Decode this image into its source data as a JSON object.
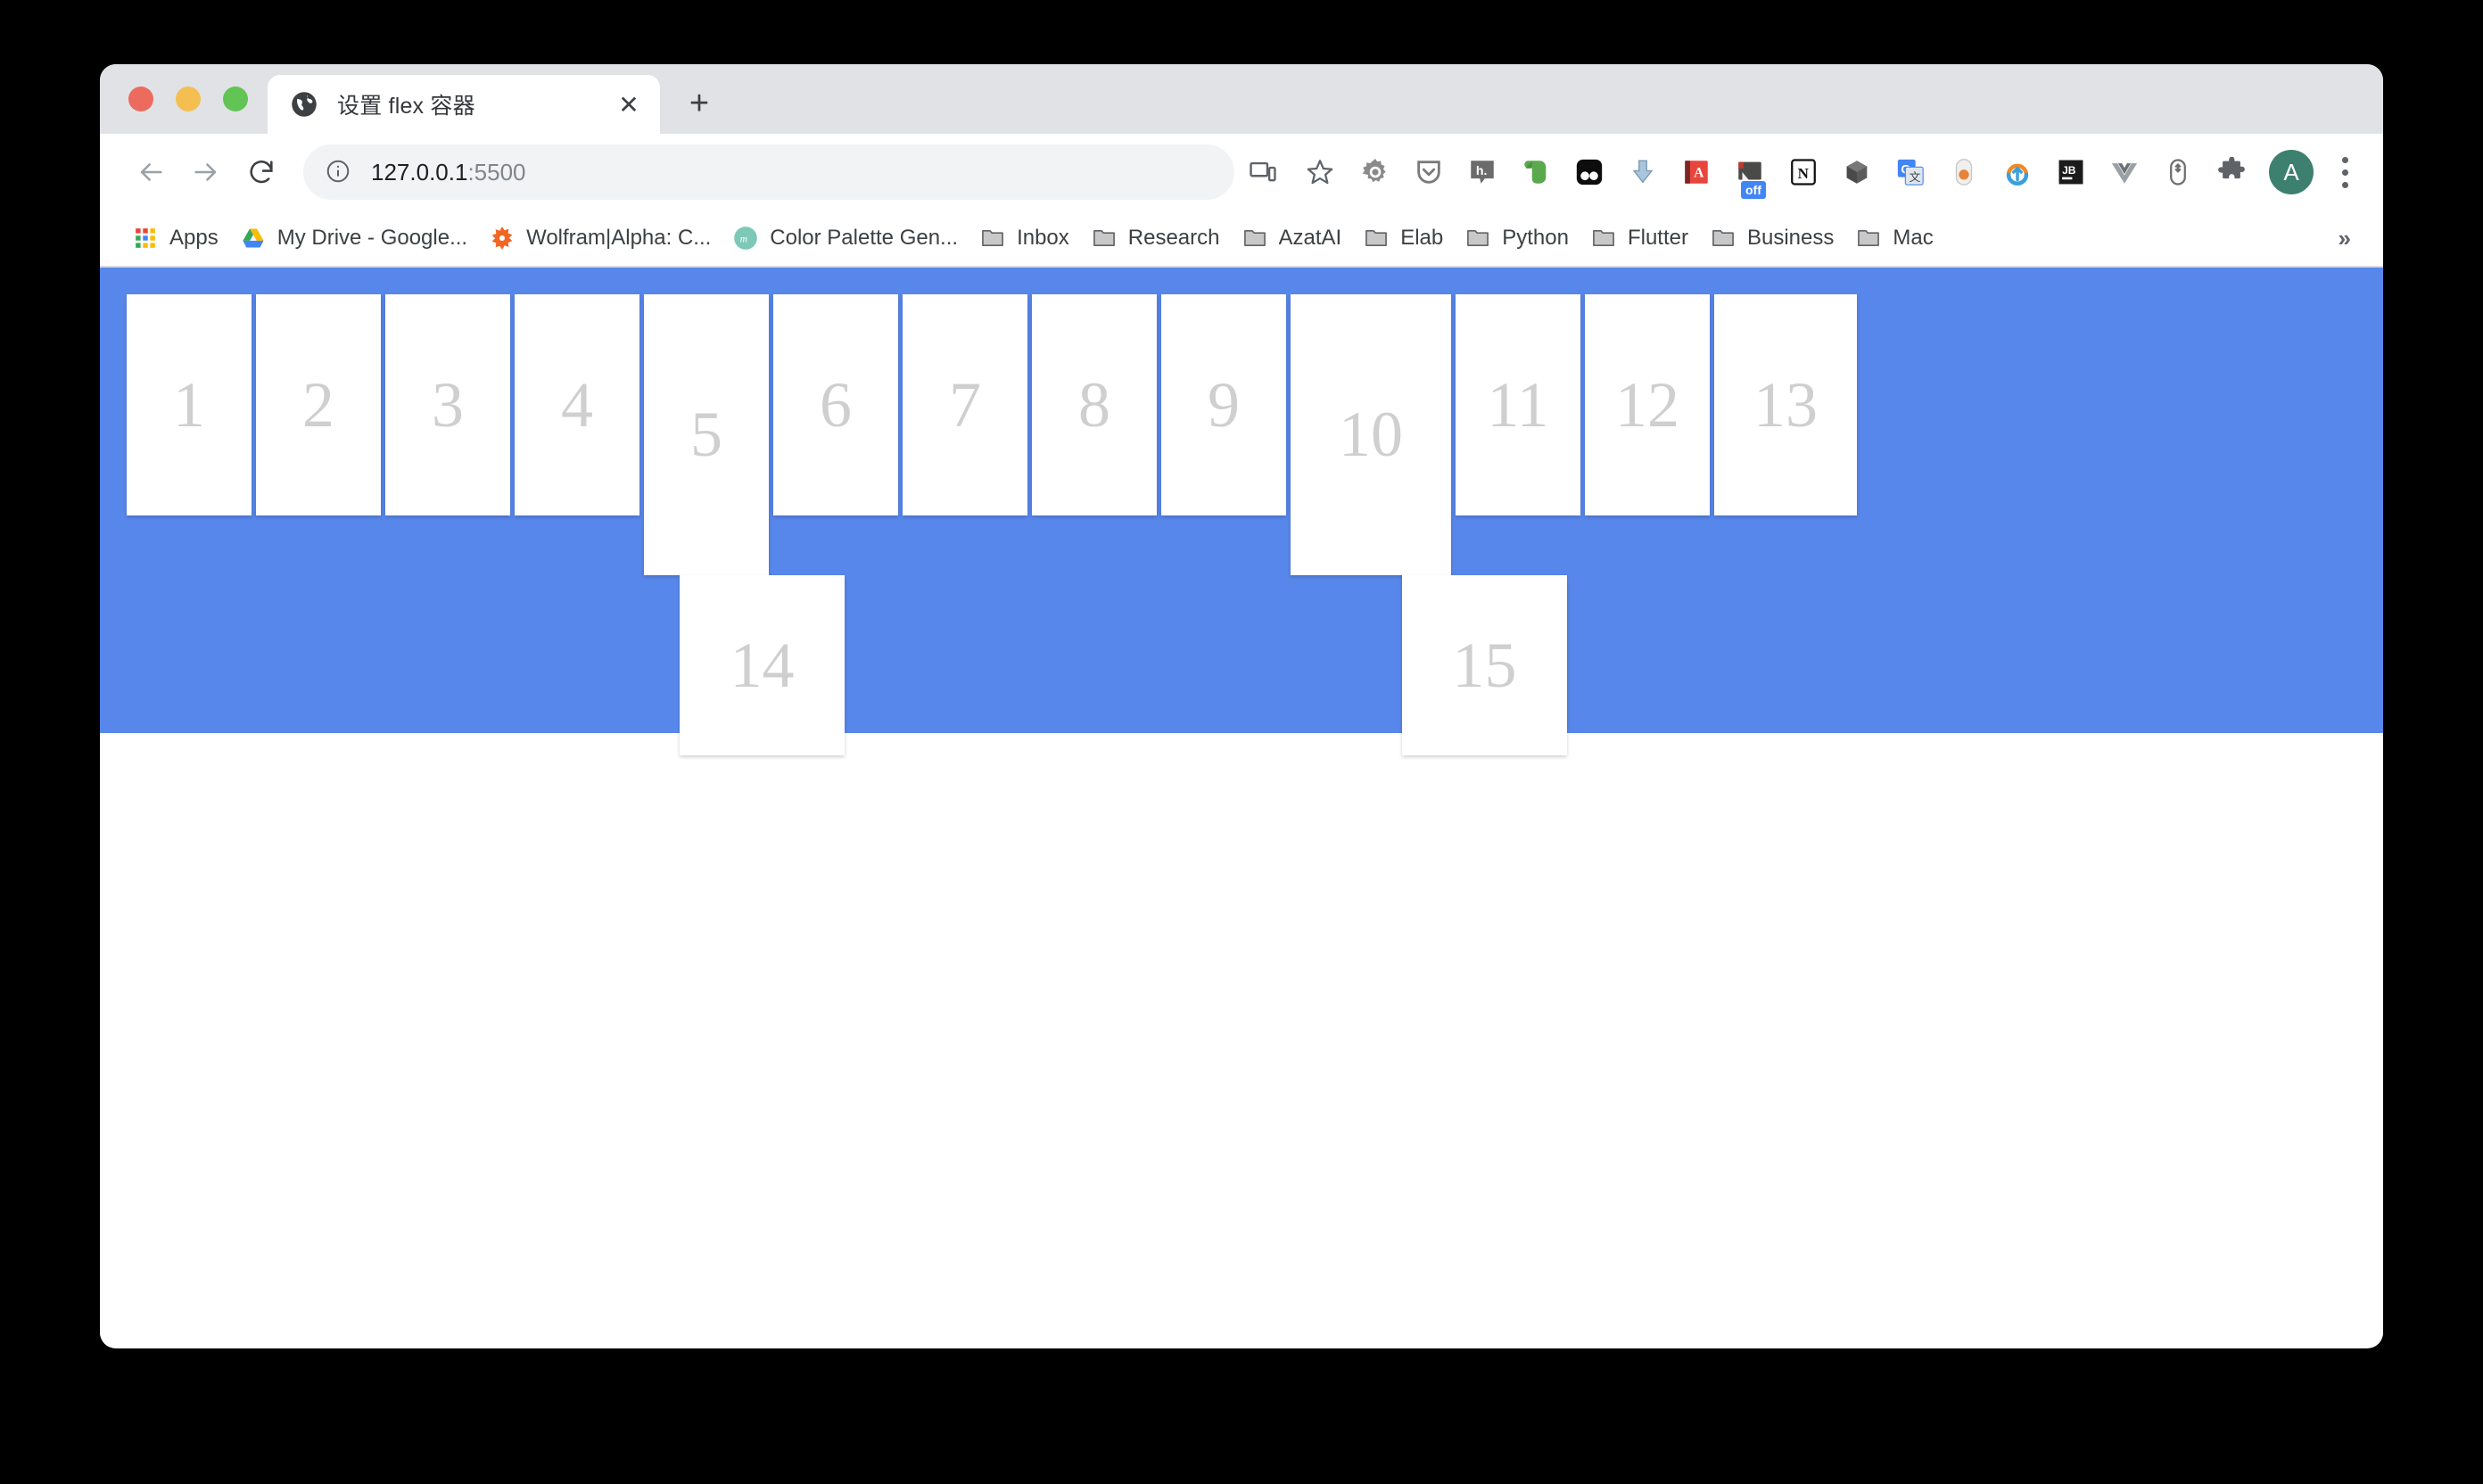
{
  "window": {
    "traffic_lights": [
      "close",
      "minimize",
      "maximize"
    ]
  },
  "tab": {
    "title": "设置 flex 容器",
    "favicon": "globe-icon",
    "close_label": "✕",
    "new_tab_label": "+"
  },
  "toolbar": {
    "back_label": "←",
    "forward_label": "→",
    "reload_label": "⟳",
    "url_host": "127.0.0.1",
    "url_port": ":5500",
    "site_info_icon": "info-circle-icon",
    "cast_icon": "cast-icon",
    "bookmark_star_icon": "star-icon",
    "extensions": [
      {
        "name": "gear-extension-icon",
        "badge": ""
      },
      {
        "name": "pocket-shield-icon",
        "badge": ""
      },
      {
        "name": "hypothesis-icon",
        "badge": ""
      },
      {
        "name": "evernote-icon",
        "badge": ""
      },
      {
        "name": "instapaper-icon",
        "badge": ""
      },
      {
        "name": "download-arrow-icon",
        "badge": ""
      },
      {
        "name": "dictionary-book-icon",
        "badge": ""
      },
      {
        "name": "toggle-extension-icon",
        "badge": "off"
      },
      {
        "name": "notion-icon",
        "badge": ""
      },
      {
        "name": "cube-icon",
        "badge": ""
      },
      {
        "name": "google-translate-icon",
        "badge": ""
      },
      {
        "name": "capsule-icon",
        "badge": ""
      },
      {
        "name": "orange-circle-arrow-icon",
        "badge": ""
      },
      {
        "name": "jetbrains-icon",
        "badge": ""
      },
      {
        "name": "vue-icon",
        "badge": ""
      },
      {
        "name": "mouse-scroll-icon",
        "badge": ""
      },
      {
        "name": "puzzle-extensions-icon",
        "badge": ""
      }
    ],
    "avatar_letter": "A",
    "menu_icon": "three-dot-menu-icon"
  },
  "bookmarks": {
    "items": [
      {
        "label": "Apps",
        "icon": "apps-grid-icon"
      },
      {
        "label": "My Drive - Google...",
        "icon": "google-drive-icon"
      },
      {
        "label": "Wolfram|Alpha: C...",
        "icon": "wolfram-icon"
      },
      {
        "label": "Color Palette Gen...",
        "icon": "muzli-icon"
      },
      {
        "label": "Inbox",
        "icon": "folder-icon"
      },
      {
        "label": "Research",
        "icon": "folder-icon"
      },
      {
        "label": "AzatAI",
        "icon": "folder-icon"
      },
      {
        "label": "Elab",
        "icon": "folder-icon"
      },
      {
        "label": "Python",
        "icon": "folder-icon"
      },
      {
        "label": "Flutter",
        "icon": "folder-icon"
      },
      {
        "label": "Business",
        "icon": "folder-icon"
      },
      {
        "label": "Mac",
        "icon": "folder-icon"
      }
    ],
    "overflow_label": "»"
  },
  "page": {
    "container_color": "#5887eb",
    "item_color": "#ffffff",
    "item_text_color": "#cfcfcf",
    "row1": [
      {
        "label": "1",
        "width": 140,
        "tall": false
      },
      {
        "label": "2",
        "width": 140,
        "tall": false
      },
      {
        "label": "3",
        "width": 140,
        "tall": false
      },
      {
        "label": "4",
        "width": 140,
        "tall": false
      },
      {
        "label": "5",
        "width": 140,
        "tall": true
      },
      {
        "label": "6",
        "width": 140,
        "tall": false
      },
      {
        "label": "7",
        "width": 140,
        "tall": false
      },
      {
        "label": "8",
        "width": 140,
        "tall": false
      },
      {
        "label": "9",
        "width": 140,
        "tall": false
      },
      {
        "label": "10",
        "width": 180,
        "tall": false
      },
      {
        "label": "11",
        "width": 140,
        "tall": false
      },
      {
        "label": "12",
        "width": 140,
        "tall": false
      },
      {
        "label": "13",
        "width": 160,
        "tall": false
      }
    ],
    "row2": [
      {
        "label": "14",
        "offset": 620,
        "width": 185
      },
      {
        "label": "15",
        "offset": 620,
        "width": 185
      }
    ]
  }
}
